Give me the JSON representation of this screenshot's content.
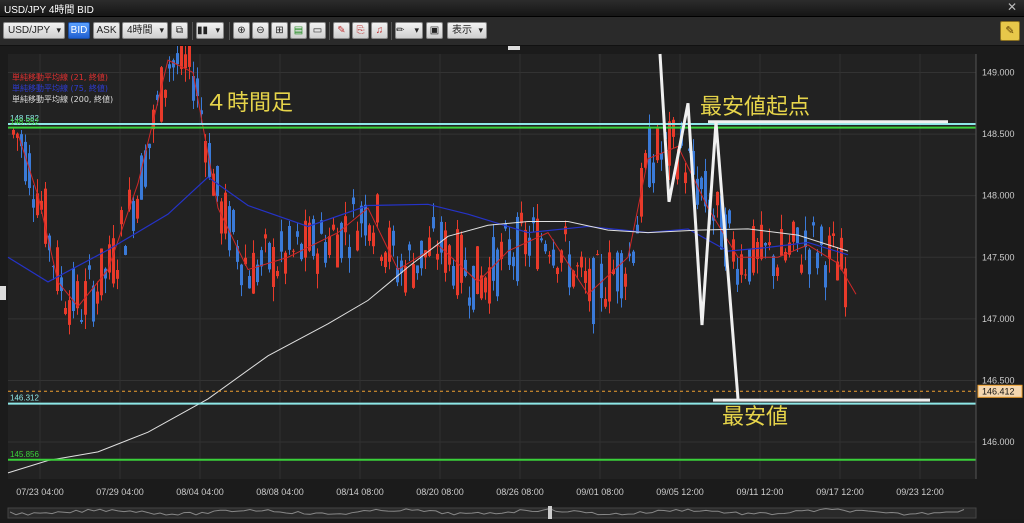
{
  "window": {
    "title": "USD/JPY 4時間 BID",
    "close_icon": "close-icon"
  },
  "toolbar": {
    "pair": "USD/JPY",
    "bid": "BID",
    "ask": "ASK",
    "timeframe": "4時間",
    "display": "表示"
  },
  "indicators": [
    {
      "label": "単純移動平均線 (21, 終値)",
      "color": "#e03030"
    },
    {
      "label": "単純移動平均線 (75, 終値)",
      "color": "#2d3bd0"
    },
    {
      "label": "単純移動平均線 (200, 終値)",
      "color": "#dddddd"
    }
  ],
  "annotations": {
    "timeframe_label": "４時間足",
    "start_label": "最安値起点",
    "low_label": "最安値"
  },
  "colors": {
    "up": "#e83a2a",
    "down": "#3a7ad8",
    "ma21": "#d02828",
    "ma75": "#2533c8",
    "ma200": "#e0e0e0",
    "cyan_line": "#8ee8e8",
    "green_line": "#3ad03a",
    "annotation": "#e6d44a",
    "price_tag": "#f0a030"
  },
  "chart_data": {
    "type": "candlestick",
    "yticks": [
      "149.000",
      "148.500",
      "148.000",
      "147.500",
      "147.000",
      "146.500",
      "146.000"
    ],
    "xticks": [
      "07/23 04:00",
      "07/29 04:00",
      "08/04 04:00",
      "08/08 04:00",
      "08/14 08:00",
      "08/20 08:00",
      "08/26 08:00",
      "09/01 08:00",
      "09/05 12:00",
      "09/11 12:00",
      "09/17 12:00",
      "09/23 12:00"
    ],
    "ylim": [
      145.7,
      149.15
    ],
    "current_price": "146.412",
    "hlines": [
      {
        "price": 148.582,
        "label": "148.582",
        "color": "#8ee8e8"
      },
      {
        "price": 148.552,
        "label": "148.552",
        "color": "#3ad03a"
      },
      {
        "price": 146.312,
        "label": "146.312",
        "color": "#8ee8e8"
      },
      {
        "price": 145.856,
        "label": "145.856",
        "color": "#3ad03a"
      }
    ],
    "ma200": [
      [
        0,
        145.75
      ],
      [
        40,
        145.85
      ],
      [
        90,
        145.92
      ],
      [
        140,
        146.08
      ],
      [
        200,
        146.35
      ],
      [
        260,
        146.7
      ],
      [
        320,
        146.96
      ],
      [
        360,
        147.15
      ],
      [
        400,
        147.42
      ],
      [
        440,
        147.67
      ],
      [
        480,
        147.76
      ],
      [
        520,
        147.79
      ],
      [
        560,
        147.79
      ],
      [
        600,
        147.72
      ],
      [
        640,
        147.7
      ],
      [
        690,
        147.72
      ],
      [
        740,
        147.73
      ],
      [
        790,
        147.68
      ],
      [
        840,
        147.55
      ]
    ],
    "ma75": [
      [
        0,
        147.5
      ],
      [
        40,
        147.3
      ],
      [
        100,
        147.56
      ],
      [
        160,
        147.85
      ],
      [
        200,
        148.15
      ],
      [
        240,
        147.92
      ],
      [
        300,
        147.75
      ],
      [
        360,
        147.92
      ],
      [
        420,
        147.93
      ],
      [
        460,
        147.85
      ],
      [
        520,
        147.7
      ],
      [
        580,
        147.75
      ],
      [
        640,
        147.7
      ],
      [
        680,
        147.73
      ],
      [
        720,
        147.55
      ],
      [
        760,
        147.58
      ],
      [
        800,
        147.62
      ],
      [
        840,
        147.52
      ]
    ],
    "ma21": [
      [
        10,
        148.5
      ],
      [
        30,
        148.0
      ],
      [
        50,
        147.3
      ],
      [
        70,
        147.1
      ],
      [
        100,
        147.4
      ],
      [
        130,
        148.1
      ],
      [
        160,
        149.1
      ],
      [
        185,
        149.0
      ],
      [
        210,
        147.9
      ],
      [
        240,
        147.4
      ],
      [
        280,
        147.5
      ],
      [
        330,
        147.7
      ],
      [
        360,
        147.9
      ],
      [
        390,
        147.4
      ],
      [
        430,
        147.6
      ],
      [
        470,
        147.3
      ],
      [
        500,
        147.55
      ],
      [
        540,
        147.7
      ],
      [
        580,
        147.2
      ],
      [
        620,
        147.5
      ],
      [
        640,
        148.3
      ],
      [
        670,
        148.4
      ],
      [
        700,
        147.9
      ],
      [
        730,
        147.5
      ],
      [
        770,
        147.5
      ],
      [
        800,
        147.6
      ],
      [
        830,
        147.45
      ],
      [
        848,
        147.2
      ]
    ],
    "drawn_zigzag": [
      [
        652,
        149.15
      ],
      [
        661,
        147.95
      ],
      [
        680,
        148.75
      ],
      [
        694,
        146.95
      ],
      [
        708,
        148.6
      ],
      [
        730,
        146.35
      ]
    ]
  }
}
